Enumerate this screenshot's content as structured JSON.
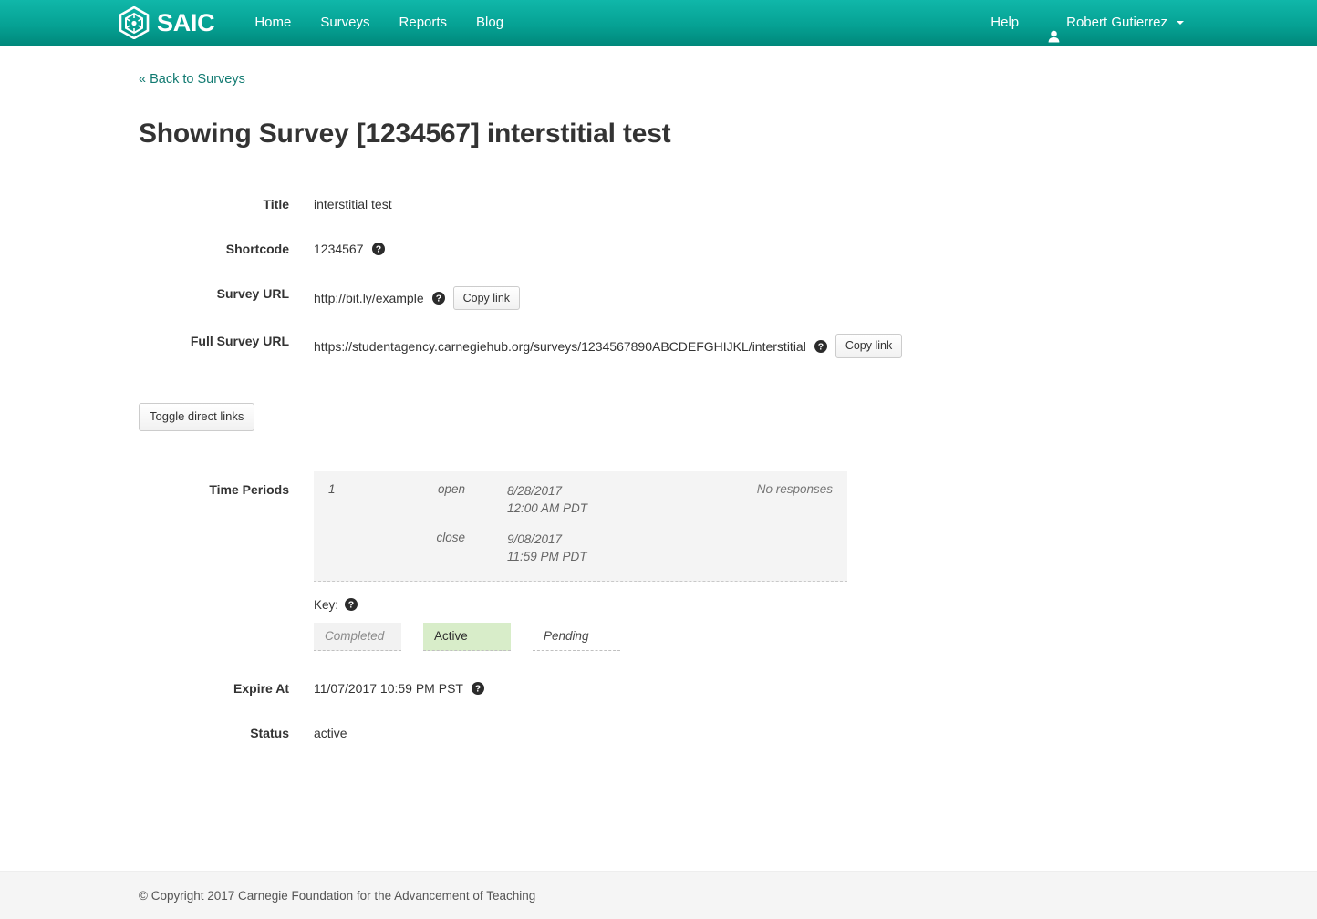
{
  "navbar": {
    "brand_text": "SAIC",
    "brand_icon": "hexagon-logo-icon",
    "links": [
      {
        "label": "Home"
      },
      {
        "label": "Surveys"
      },
      {
        "label": "Reports"
      },
      {
        "label": "Blog"
      }
    ],
    "help_label": "Help",
    "user_name": "Robert Gutierrez",
    "user_icon": "person-icon",
    "caret_icon": "caret-down-icon",
    "gradient_top": "#10b7a9",
    "gradient_bottom": "#00887b"
  },
  "page": {
    "back_link": "« Back to Surveys",
    "title": "Showing Survey [1234567] interstitial test",
    "link_color": "#117a71"
  },
  "fields": {
    "title_label": "Title",
    "title_value": "interstitial test",
    "shortcode_label": "Shortcode",
    "shortcode_value": "1234567",
    "survey_url_label": "Survey URL",
    "survey_url_value": "http://bit.ly/example",
    "full_survey_url_label": "Full Survey URL",
    "full_survey_url_value": "https://studentagency.carnegiehub.org/surveys/1234567890ABCDEFGHIJKL/interstitial",
    "copy_link_label": "Copy link",
    "help_icon": "help-circle-icon"
  },
  "toggle_button": {
    "label": "Toggle direct links"
  },
  "time_periods": {
    "label": "Time Periods",
    "entries": [
      {
        "index": "1",
        "open_label": "open",
        "open_date": "8/28/2017",
        "open_time": "12:00 AM PDT",
        "close_label": "close",
        "close_date": "9/08/2017",
        "close_time": "11:59 PM PDT",
        "responses": "No responses"
      }
    ]
  },
  "key": {
    "caption": "Key:",
    "help_icon": "help-circle-icon",
    "chips": [
      {
        "label": "Completed",
        "state": "completed",
        "color": "#f2f2f2"
      },
      {
        "label": "Active",
        "state": "active",
        "color": "#d8edc9"
      },
      {
        "label": "Pending",
        "state": "pending",
        "color": "#ffffff"
      }
    ]
  },
  "expire": {
    "label": "Expire At",
    "value": "11/07/2017 10:59 PM PST"
  },
  "status": {
    "label": "Status",
    "value": "active"
  },
  "footer": {
    "text": "© Copyright 2017 Carnegie Foundation for the Advancement of Teaching"
  }
}
